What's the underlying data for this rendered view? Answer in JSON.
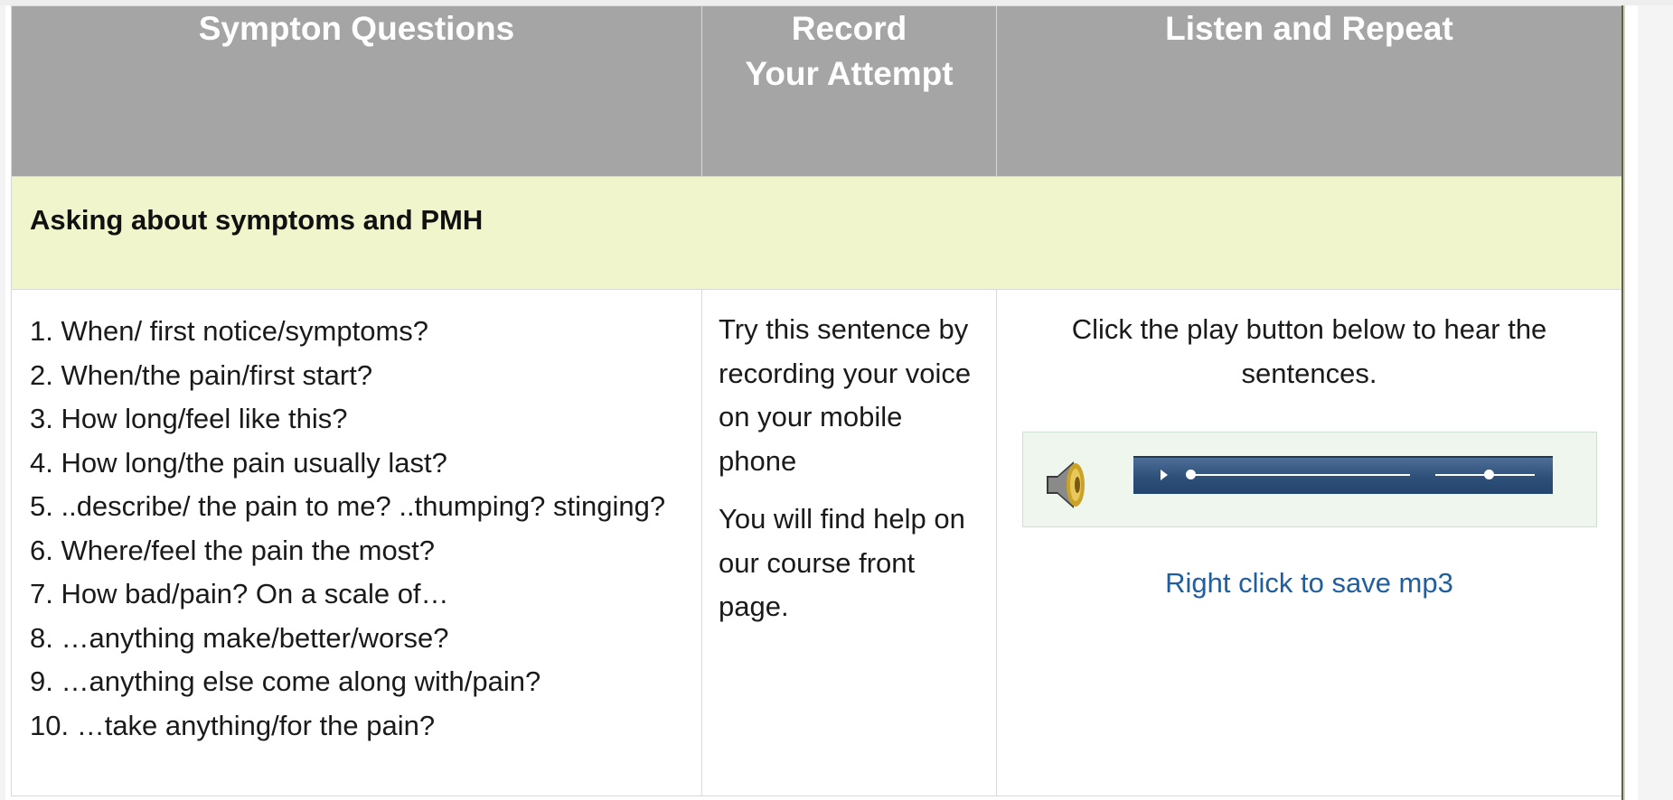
{
  "table": {
    "headers": {
      "questions": "Sympton Questions",
      "record_line1": "Record",
      "record_line2": "Your Attempt",
      "listen": "Listen and Repeat"
    },
    "section_title": "Asking about symptoms and PMH",
    "questions": [
      "1. When/ first notice/symptoms?",
      "2. When/the pain/first start?",
      "3. How long/feel like this?",
      "4. How long/the pain usually last?",
      "5. ..describe/ the pain to me? ..thumping? stinging?",
      "6. Where/feel the pain the most?",
      "7. How bad/pain? On a scale of…",
      "8. …anything make/better/worse?",
      "9. …anything else come along with/pain?",
      "10. …take anything/for the pain?"
    ],
    "attempt_text_1": "Try this sentence by recording your voice on your mobile phone",
    "attempt_text_2": "You will find help on our course front page.",
    "listen_text": "Click the play button below to hear the sentences.",
    "save_link": "Right click to save mp3"
  },
  "player": {
    "speaker_icon": "speaker-icon",
    "progress": 0.0,
    "volume": 0.55
  }
}
